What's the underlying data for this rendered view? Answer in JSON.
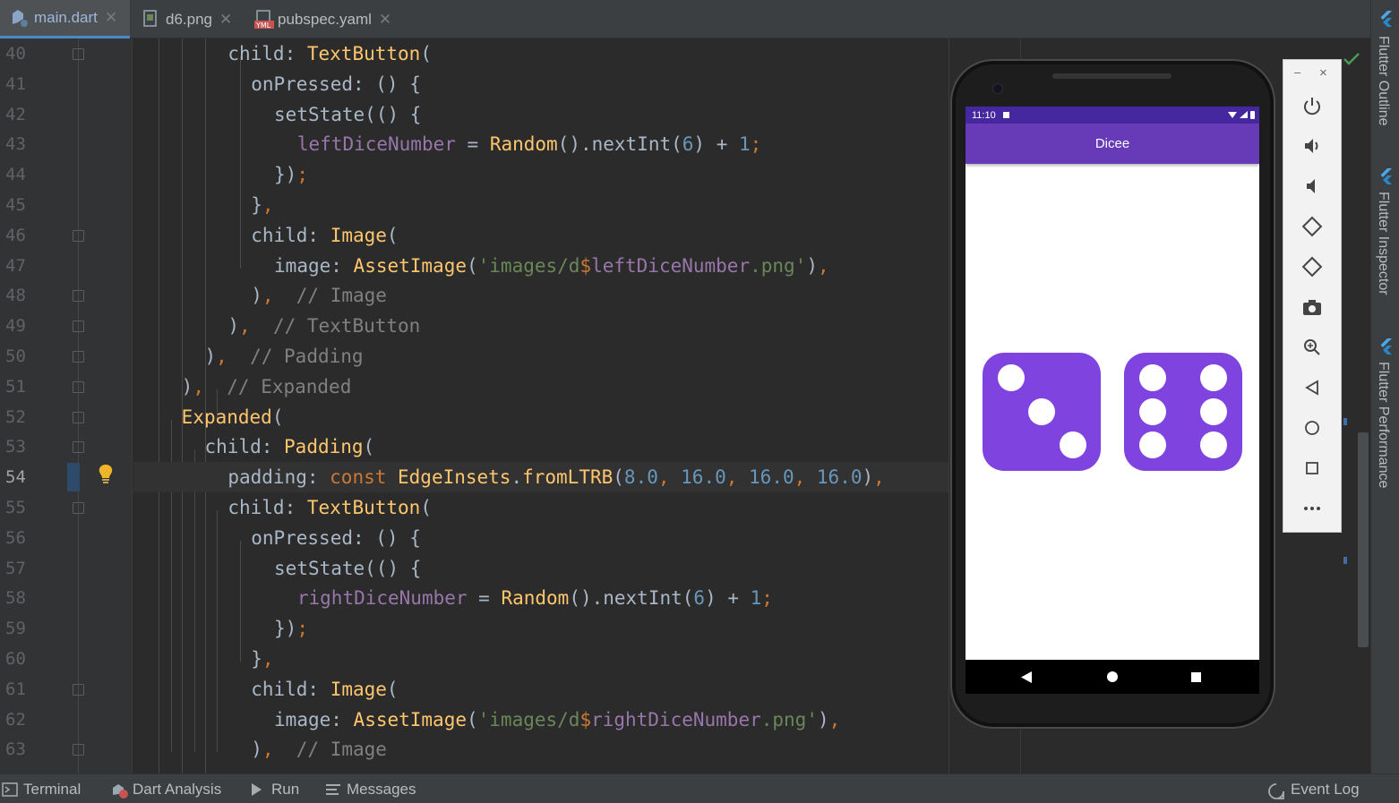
{
  "tabs": [
    {
      "label": "main.dart",
      "active": true,
      "icon": "dart-file-icon"
    },
    {
      "label": "d6.png",
      "active": false,
      "icon": "image-file-icon"
    },
    {
      "label": "pubspec.yaml",
      "active": false,
      "icon": "yaml-file-icon"
    }
  ],
  "tab_close_glyph": "✕",
  "line_numbers": [
    "40",
    "41",
    "42",
    "43",
    "44",
    "45",
    "46",
    "47",
    "48",
    "49",
    "50",
    "51",
    "52",
    "53",
    "54",
    "55",
    "56",
    "57",
    "58",
    "59",
    "60",
    "61",
    "62",
    "63"
  ],
  "current_line": "54",
  "code": [
    [
      {
        "t": "child: ",
        "c": "p"
      },
      {
        "t": "TextButton",
        "c": "cls"
      },
      {
        "t": "(",
        "c": "p"
      }
    ],
    [
      {
        "t": "onPressed: () {",
        "c": "p"
      }
    ],
    [
      {
        "t": "setState(() {",
        "c": "p"
      }
    ],
    [
      {
        "t": "leftDiceNumber",
        "c": "fld"
      },
      {
        "t": " = ",
        "c": "p"
      },
      {
        "t": "Random",
        "c": "cls"
      },
      {
        "t": "().nextInt(",
        "c": "p"
      },
      {
        "t": "6",
        "c": "num"
      },
      {
        "t": ") + ",
        "c": "p"
      },
      {
        "t": "1",
        "c": "num"
      },
      {
        "t": ";",
        "c": "kw"
      }
    ],
    [
      {
        "t": "})",
        "c": "p"
      },
      {
        "t": ";",
        "c": "kw"
      }
    ],
    [
      {
        "t": "}",
        "c": "p"
      },
      {
        "t": ",",
        "c": "kw"
      }
    ],
    [
      {
        "t": "child: ",
        "c": "p"
      },
      {
        "t": "Image",
        "c": "cls"
      },
      {
        "t": "(",
        "c": "p"
      }
    ],
    [
      {
        "t": "image: ",
        "c": "p"
      },
      {
        "t": "AssetImage",
        "c": "cls"
      },
      {
        "t": "(",
        "c": "p"
      },
      {
        "t": "'images/d",
        "c": "str"
      },
      {
        "t": "$",
        "c": "kw"
      },
      {
        "t": "leftDiceNumber",
        "c": "fld"
      },
      {
        "t": ".png'",
        "c": "str"
      },
      {
        "t": ")",
        "c": "p"
      },
      {
        "t": ",",
        "c": "kw"
      }
    ],
    [
      {
        "t": ")",
        "c": "p"
      },
      {
        "t": ",  ",
        "c": "kw"
      },
      {
        "t": "// Image",
        "c": "cm"
      }
    ],
    [
      {
        "t": ")",
        "c": "p"
      },
      {
        "t": ",  ",
        "c": "kw"
      },
      {
        "t": "// TextButton",
        "c": "cm"
      }
    ],
    [
      {
        "t": ")",
        "c": "p"
      },
      {
        "t": ",  ",
        "c": "kw"
      },
      {
        "t": "// Padding",
        "c": "cm"
      }
    ],
    [
      {
        "t": ")",
        "c": "p"
      },
      {
        "t": ",  ",
        "c": "kw"
      },
      {
        "t": "// Expanded",
        "c": "cm"
      }
    ],
    [
      {
        "t": "Expanded",
        "c": "cls"
      },
      {
        "t": "(",
        "c": "p"
      }
    ],
    [
      {
        "t": "child: ",
        "c": "p"
      },
      {
        "t": "Padding",
        "c": "cls"
      },
      {
        "t": "(",
        "c": "p"
      }
    ],
    [
      {
        "t": "padding: ",
        "c": "p"
      },
      {
        "t": "const ",
        "c": "kw"
      },
      {
        "t": "EdgeInsets",
        "c": "cls"
      },
      {
        "t": ".",
        "c": "p"
      },
      {
        "t": "fromLTRB",
        "c": "cls"
      },
      {
        "t": "(",
        "c": "p"
      },
      {
        "t": "8.0",
        "c": "num"
      },
      {
        "t": ", ",
        "c": "kw"
      },
      {
        "t": "16.0",
        "c": "num"
      },
      {
        "t": ", ",
        "c": "kw"
      },
      {
        "t": "16.0",
        "c": "num"
      },
      {
        "t": ", ",
        "c": "kw"
      },
      {
        "t": "16.0",
        "c": "num"
      },
      {
        "t": ")",
        "c": "p"
      },
      {
        "t": ",",
        "c": "kw"
      }
    ],
    [
      {
        "t": "child: ",
        "c": "p"
      },
      {
        "t": "TextButton",
        "c": "cls"
      },
      {
        "t": "(",
        "c": "p"
      }
    ],
    [
      {
        "t": "onPressed: () {",
        "c": "p"
      }
    ],
    [
      {
        "t": "setState(() {",
        "c": "p"
      }
    ],
    [
      {
        "t": "rightDiceNumber",
        "c": "fld"
      },
      {
        "t": " = ",
        "c": "p"
      },
      {
        "t": "Random",
        "c": "cls"
      },
      {
        "t": "().nextInt(",
        "c": "p"
      },
      {
        "t": "6",
        "c": "num"
      },
      {
        "t": ") + ",
        "c": "p"
      },
      {
        "t": "1",
        "c": "num"
      },
      {
        "t": ";",
        "c": "kw"
      }
    ],
    [
      {
        "t": "})",
        "c": "p"
      },
      {
        "t": ";",
        "c": "kw"
      }
    ],
    [
      {
        "t": "}",
        "c": "p"
      },
      {
        "t": ",",
        "c": "kw"
      }
    ],
    [
      {
        "t": "child: ",
        "c": "p"
      },
      {
        "t": "Image",
        "c": "cls"
      },
      {
        "t": "(",
        "c": "p"
      }
    ],
    [
      {
        "t": "image: ",
        "c": "p"
      },
      {
        "t": "AssetImage",
        "c": "cls"
      },
      {
        "t": "(",
        "c": "p"
      },
      {
        "t": "'images/d",
        "c": "str"
      },
      {
        "t": "$",
        "c": "kw"
      },
      {
        "t": "rightDiceNumber",
        "c": "fld"
      },
      {
        "t": ".png'",
        "c": "str"
      },
      {
        "t": ")",
        "c": "p"
      },
      {
        "t": ",",
        "c": "kw"
      }
    ],
    [
      {
        "t": ")",
        "c": "p"
      },
      {
        "t": ",  ",
        "c": "kw"
      },
      {
        "t": "// Image",
        "c": "cm"
      }
    ]
  ],
  "syntax_colors": {
    "p": "#a9b7c6",
    "kw": "#cc7832",
    "cls": "#ffc66d",
    "num": "#6897bb",
    "str": "#6a8759",
    "cm": "#808080",
    "fld": "#9876aa"
  },
  "emulator": {
    "status_time": "11:10",
    "app_title": "Dicee",
    "left_die": 3,
    "right_die": 6,
    "die_color": "#7f44e0",
    "appbar_color": "#673ab7",
    "statusbar_color": "#4527a0",
    "window_minimize": "–",
    "window_close": "×",
    "toolbar_buttons": [
      "power-icon",
      "volume-up-icon",
      "volume-down-icon",
      "rotate-left-icon",
      "rotate-right-icon",
      "camera-icon",
      "zoom-icon",
      "back-icon",
      "home-icon",
      "overview-icon",
      "more-icon"
    ]
  },
  "right_tools": [
    "Flutter Outline",
    "Flutter Inspector",
    "Flutter Performance"
  ],
  "bottom_tools": {
    "terminal": "Terminal",
    "dart_analysis": "Dart Analysis",
    "run": "Run",
    "messages": "Messages",
    "event_log": "Event Log"
  }
}
